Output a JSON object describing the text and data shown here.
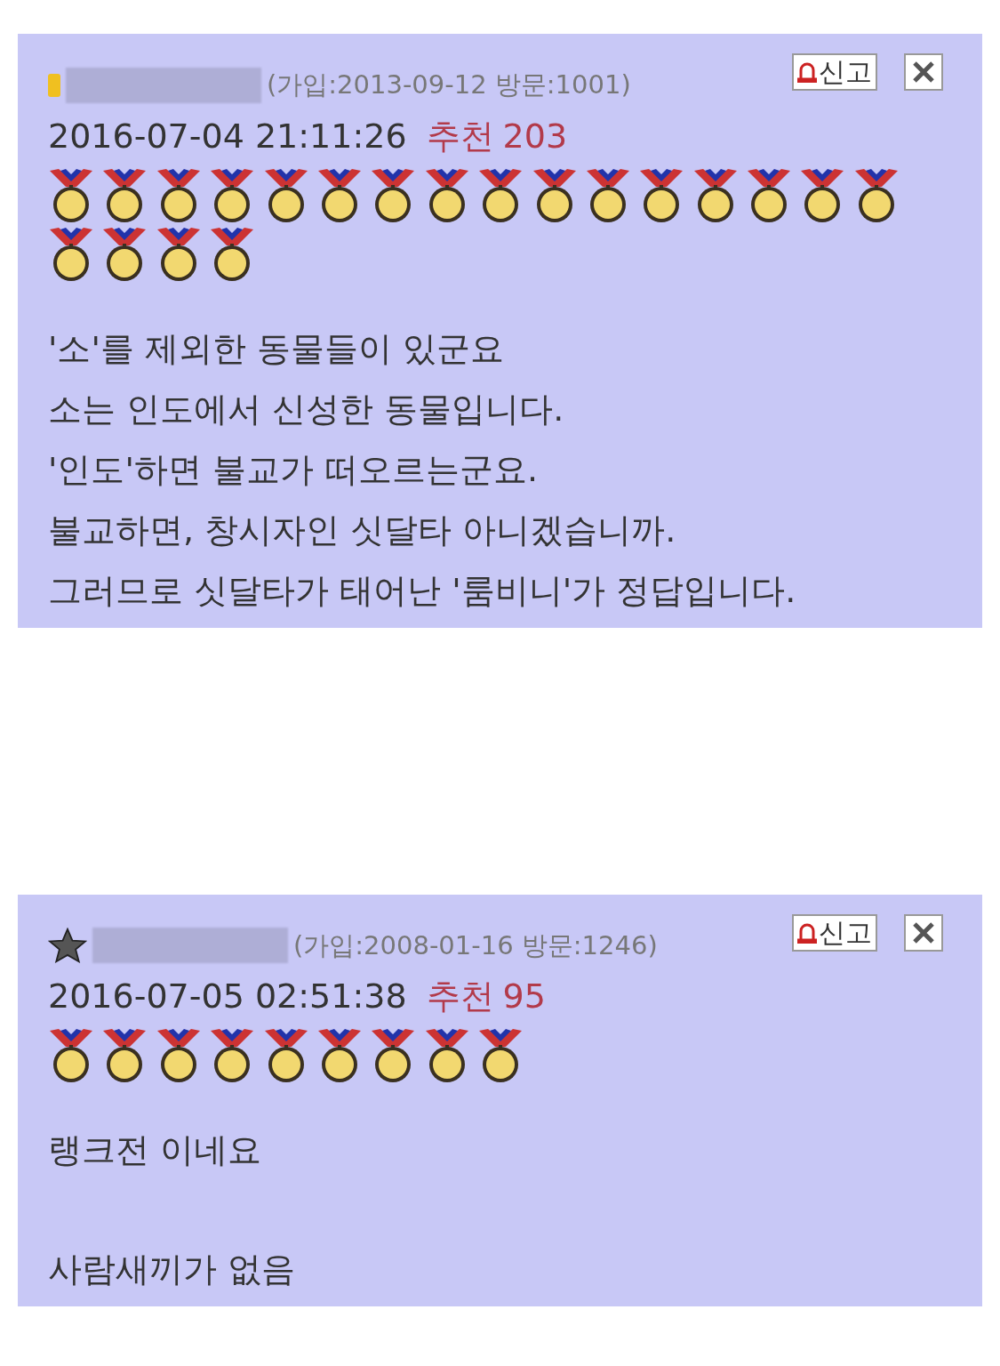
{
  "comments": [
    {
      "kind": "gold",
      "meta": "(가입:2013-09-12 방문:1001)",
      "report": "신고",
      "datetime": "2016-07-04 21:11:26",
      "recommend_label": "추천",
      "recommend_count": "203",
      "medals": [
        {
          "kind": "medal"
        },
        {
          "kind": "medal"
        },
        {
          "kind": "medal"
        },
        {
          "kind": "medal"
        },
        {
          "kind": "medal"
        },
        {
          "kind": "medal"
        },
        {
          "kind": "medal"
        },
        {
          "kind": "medal"
        },
        {
          "kind": "medal"
        },
        {
          "kind": "medal"
        },
        {
          "kind": "medal"
        },
        {
          "kind": "medal"
        },
        {
          "kind": "medal"
        },
        {
          "kind": "medal"
        },
        {
          "kind": "medal"
        },
        {
          "kind": "medal"
        },
        {
          "kind": "medal"
        },
        {
          "kind": "medal"
        },
        {
          "kind": "medal"
        },
        {
          "kind": "medal"
        }
      ],
      "paragraphs": [
        [
          "'소'를 제외한 동물들이 있군요",
          "소는 인도에서 신성한 동물입니다.",
          "'인도'하면 불교가 떠오르는군요.",
          "불교하면, 창시자인 싯달타 아니겠습니까.",
          "그러므로 싯달타가 태어난 '룸비니'가 정답입니다."
        ]
      ]
    },
    {
      "kind": "star",
      "meta": "(가입:2008-01-16 방문:1246)",
      "report": "신고",
      "datetime": "2016-07-05 02:51:38",
      "recommend_label": "추천",
      "recommend_count": "95",
      "medals": [
        {
          "kind": "medal"
        },
        {
          "kind": "medal"
        },
        {
          "kind": "medal"
        },
        {
          "kind": "medal"
        },
        {
          "kind": "medal"
        },
        {
          "kind": "medal"
        },
        {
          "kind": "medal"
        },
        {
          "kind": "medal"
        },
        {
          "kind": "medal"
        }
      ],
      "paragraphs": [
        [
          "랭크전 이네요"
        ],
        [
          "사람새끼가 없음"
        ]
      ]
    }
  ]
}
